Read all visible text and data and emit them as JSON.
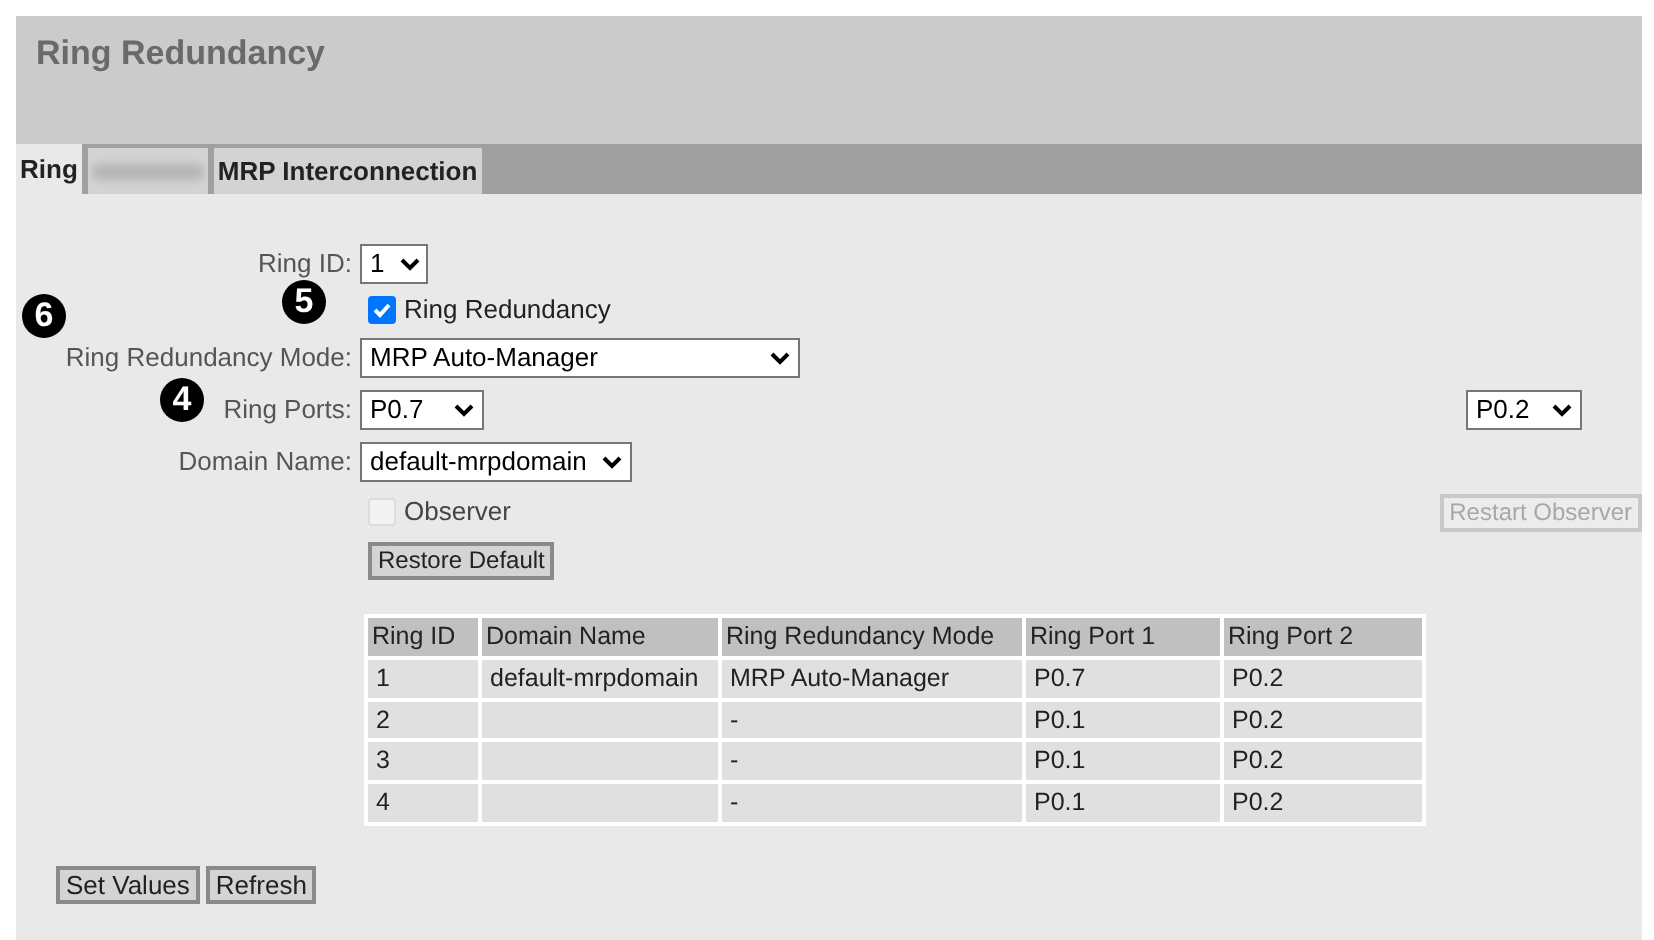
{
  "page_title": "Ring Redundancy",
  "tabs": [
    {
      "label": "Ring",
      "selected": true,
      "blurred": false
    },
    {
      "selected": false,
      "blurred": true
    },
    {
      "label": "MRP Interconnection",
      "selected": false,
      "blurred": false
    }
  ],
  "form": {
    "ring_id": {
      "label": "Ring ID:",
      "value": "1"
    },
    "ring_redundancy": {
      "label": "Ring Redundancy",
      "checked": true
    },
    "mode": {
      "label": "Ring Redundancy Mode:",
      "value": "MRP Auto-Manager"
    },
    "ring_ports": {
      "label": "Ring Ports:",
      "port_1": "P0.7",
      "port_2": "P0.2"
    },
    "domain": {
      "label": "Domain Name:",
      "value": "default-mrpdomain"
    },
    "observer": {
      "label": "Observer",
      "checked": false,
      "disabled": true
    },
    "restart_observer": {
      "label": "Restart Observer",
      "disabled": true
    },
    "restore_default": {
      "label": "Restore Default",
      "disabled": false
    }
  },
  "callouts": [
    {
      "number": "6"
    },
    {
      "number": "5"
    },
    {
      "number": "4"
    }
  ],
  "table": {
    "columns": [
      "Ring ID",
      "Domain Name",
      "Ring Redundancy Mode",
      "Ring Port 1",
      "Ring Port 2"
    ],
    "rows": [
      [
        "1",
        "default-mrpdomain",
        "MRP Auto-Manager",
        "P0.7",
        "P0.2"
      ],
      [
        "2",
        "",
        "-",
        "P0.1",
        "P0.2"
      ],
      [
        "3",
        "",
        "-",
        "P0.1",
        "P0.2"
      ],
      [
        "4",
        "",
        "-",
        "P0.1",
        "P0.2"
      ]
    ]
  },
  "buttons": [
    "Set Values",
    "Refresh"
  ]
}
